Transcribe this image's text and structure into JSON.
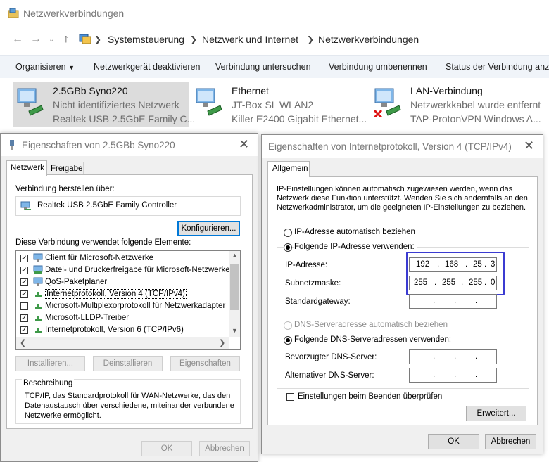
{
  "explorer": {
    "title": "Netzwerkverbindungen",
    "breadcrumb": [
      "Systemsteuerung",
      "Netzwerk und Internet",
      "Netzwerkverbindungen"
    ],
    "commands": [
      "Organisieren",
      "Netzwerkgerät deaktivieren",
      "Verbindung untersuchen",
      "Verbindung umbenennen",
      "Status der Verbindung anzei"
    ],
    "connections": [
      {
        "name": "2.5GBb Syno220",
        "status": "Nicht identifiziertes Netzwerk",
        "device": "Realtek USB 2.5GbE Family C..."
      },
      {
        "name": "Ethernet",
        "status": "JT-Box SL WLAN2",
        "device": "Killer E2400 Gigabit Ethernet..."
      },
      {
        "name": "LAN-Verbindung",
        "status": "Netzwerkkabel wurde entfernt",
        "device": "TAP-ProtonVPN Windows A..."
      }
    ]
  },
  "props": {
    "title": "Eigenschaften von 2.5GBb Syno220",
    "tabs": [
      "Netzwerk",
      "Freigabe"
    ],
    "connect_label": "Verbindung herstellen über:",
    "adapter": "Realtek USB 2.5GbE Family Controller",
    "configure": "Konfigurieren...",
    "items_label": "Diese Verbindung verwendet folgende Elemente:",
    "items": [
      {
        "label": "Client für Microsoft-Netzwerke",
        "checked": true
      },
      {
        "label": "Datei- und Druckerfreigabe für Microsoft-Netzwerke",
        "checked": true
      },
      {
        "label": "QoS-Paketplaner",
        "checked": true
      },
      {
        "label": "Internetprotokoll, Version 4 (TCP/IPv4)",
        "checked": true
      },
      {
        "label": "Microsoft-Multiplexorprotokoll für Netzwerkadapter",
        "checked": false
      },
      {
        "label": "Microsoft-LLDP-Treiber",
        "checked": true
      },
      {
        "label": "Internetprotokoll, Version 6 (TCP/IPv6)",
        "checked": true
      }
    ],
    "install": "Installieren...",
    "uninstall": "Deinstallieren",
    "properties": "Eigenschaften",
    "desc_title": "Beschreibung",
    "desc": "TCP/IP, das Standardprotokoll für WAN-Netzwerke, das den Datenaustausch über verschiedene, miteinander verbundene Netzwerke ermöglicht.",
    "ok": "OK",
    "cancel": "Abbrechen"
  },
  "ipv4": {
    "title": "Eigenschaften von Internetprotokoll, Version 4 (TCP/IPv4)",
    "tab": "Allgemein",
    "intro": "IP-Einstellungen können automatisch zugewiesen werden, wenn das Netzwerk diese Funktion unterstützt. Wenden Sie sich andernfalls an den Netzwerkadministrator, um die geeigneten IP-Einstellungen zu beziehen.",
    "auto_ip": "IP-Adresse automatisch beziehen",
    "manual_ip": "Folgende IP-Adresse verwenden:",
    "ip_label": "IP-Adresse:",
    "ip": [
      "192",
      "168",
      "25",
      "3"
    ],
    "mask_label": "Subnetzmaske:",
    "mask": [
      "255",
      "255",
      "255",
      "0"
    ],
    "gateway_label": "Standardgateway:",
    "auto_dns": "DNS-Serveradresse automatisch beziehen",
    "manual_dns": "Folgende DNS-Serveradressen verwenden:",
    "dns1_label": "Bevorzugter DNS-Server:",
    "dns2_label": "Alternativer DNS-Server:",
    "validate": "Einstellungen beim Beenden überprüfen",
    "advanced": "Erweitert...",
    "ok": "OK",
    "cancel": "Abbrechen"
  },
  "colors": {
    "accent": "#0078d7",
    "highlight_box": "#3b3bd1"
  }
}
